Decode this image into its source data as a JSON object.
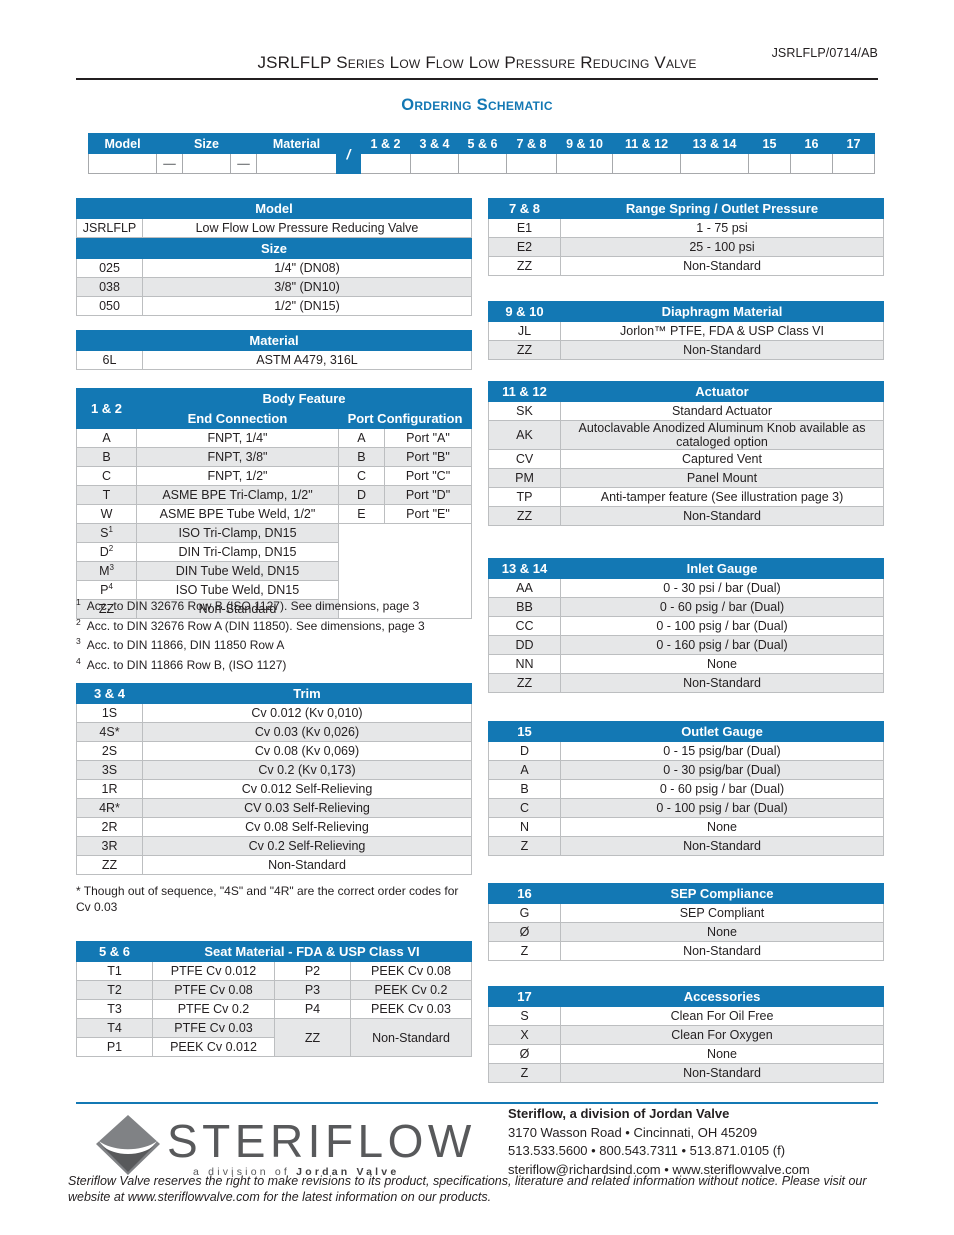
{
  "header": {
    "doc_code": "JSRLFLP/0714/AB",
    "title": "JSRLFLP Series Low Flow Low Pressure Reducing Valve",
    "section_title": "Ordering Schematic"
  },
  "colors": {
    "brand_blue": "#1378b4",
    "alt_row": "#e6e7e8",
    "border": "#bcbec0",
    "text": "#231f20",
    "logo_gray": "#58595b"
  },
  "schematic": {
    "headers": [
      "Model",
      "",
      "Size",
      "",
      "Material",
      "/",
      "1 & 2",
      "3 & 4",
      "5 & 6",
      "7 & 8",
      "9 & 10",
      "11 & 12",
      "13 & 14",
      "15",
      "16",
      "17"
    ],
    "separator": "—",
    "slash": "/"
  },
  "tables": {
    "model": {
      "code_header": "",
      "title": "Model",
      "rows": [
        {
          "code": "JSRLFLP",
          "desc": "Low Flow Low Pressure Reducing Valve"
        }
      ]
    },
    "size": {
      "title": "Size",
      "rows": [
        {
          "code": "025",
          "desc": "1/4\" (DN08)"
        },
        {
          "code": "038",
          "desc": "3/8\" (DN10)"
        },
        {
          "code": "050",
          "desc": "1/2\" (DN15)"
        }
      ]
    },
    "material": {
      "title": "Material",
      "rows": [
        {
          "code": "6L",
          "desc": "ASTM A479, 316L"
        }
      ]
    },
    "body_feature": {
      "code_label": "1 & 2",
      "title": "Body Feature",
      "sub_end": "End Connection",
      "sub_port": "Port Configuration",
      "end_rows": [
        {
          "code": "A",
          "desc": "FNPT, 1/4\""
        },
        {
          "code": "B",
          "desc": "FNPT, 3/8\""
        },
        {
          "code": "C",
          "desc": "FNPT, 1/2\""
        },
        {
          "code": "T",
          "desc": "ASME BPE Tri-Clamp, 1/2\""
        },
        {
          "code": "W",
          "desc": "ASME BPE Tube Weld, 1/2\""
        },
        {
          "code": "S",
          "sup": "1",
          "desc": "ISO Tri-Clamp, DN15"
        },
        {
          "code": "D",
          "sup": "2",
          "desc": "DIN Tri-Clamp, DN15"
        },
        {
          "code": "M",
          "sup": "3",
          "desc": "DIN Tube Weld, DN15"
        },
        {
          "code": "P",
          "sup": "4",
          "desc": "ISO Tube Weld, DN15"
        },
        {
          "code": "ZZ",
          "desc": "Non-Standard"
        }
      ],
      "port_rows": [
        {
          "code": "A",
          "desc": "Port \"A\""
        },
        {
          "code": "B",
          "desc": "Port \"B\""
        },
        {
          "code": "C",
          "desc": "Port \"C\""
        },
        {
          "code": "D",
          "desc": "Port \"D\""
        },
        {
          "code": "E",
          "desc": "Port \"E\""
        }
      ],
      "footnotes": [
        {
          "mark": "1",
          "text": "Acc. to DIN 32676 Row B (ISO 1127). See dimensions, page 3"
        },
        {
          "mark": "2",
          "text": "Acc. to DIN 32676 Row A (DIN 11850). See dimensions, page 3"
        },
        {
          "mark": "3",
          "text": "Acc. to DIN 11866, DIN 11850 Row A"
        },
        {
          "mark": "4",
          "text": "Acc. to DIN 11866 Row B, (ISO 1127)"
        }
      ]
    },
    "trim": {
      "code_label": "3 & 4",
      "title": "Trim",
      "rows": [
        {
          "code": "1S",
          "desc": "Cv 0.012 (Kv 0,010)"
        },
        {
          "code": "4S*",
          "desc": "Cv 0.03 (Kv 0,026)"
        },
        {
          "code": "2S",
          "desc": "Cv 0.08 (Kv 0,069)"
        },
        {
          "code": "3S",
          "desc": "Cv 0.2 (Kv 0,173)"
        },
        {
          "code": "1R",
          "desc": "Cv 0.012 Self-Relieving"
        },
        {
          "code": "4R*",
          "desc": "CV 0.03 Self-Relieving"
        },
        {
          "code": "2R",
          "desc": "Cv 0.08 Self-Relieving"
        },
        {
          "code": "3R",
          "desc": "Cv 0.2 Self-Relieving"
        },
        {
          "code": "ZZ",
          "desc": "Non-Standard"
        }
      ],
      "footnote": "* Though out of sequence, \"4S\" and \"4R\" are the correct order codes for Cv 0.03"
    },
    "seat_material": {
      "code_label": "5 & 6",
      "title": "Seat Material - FDA & USP Class VI",
      "left_rows": [
        {
          "code": "T1",
          "desc": "PTFE Cv 0.012"
        },
        {
          "code": "T2",
          "desc": "PTFE Cv 0.08"
        },
        {
          "code": "T3",
          "desc": "PTFE Cv 0.2"
        },
        {
          "code": "T4",
          "desc": "PTFE Cv 0.03"
        },
        {
          "code": "P1",
          "desc": "PEEK Cv 0.012"
        }
      ],
      "right_rows": [
        {
          "code": "P2",
          "desc": "PEEK Cv 0.08"
        },
        {
          "code": "P3",
          "desc": "PEEK Cv 0.2"
        },
        {
          "code": "P4",
          "desc": "PEEK Cv 0.03"
        },
        {
          "code": "ZZ",
          "desc": "Non-Standard"
        }
      ]
    },
    "range_spring": {
      "code_label": "7 & 8",
      "title": "Range Spring / Outlet Pressure",
      "rows": [
        {
          "code": "E1",
          "desc": "1 - 75 psi"
        },
        {
          "code": "E2",
          "desc": "25 - 100 psi"
        },
        {
          "code": "ZZ",
          "desc": "Non-Standard"
        }
      ]
    },
    "diaphragm": {
      "code_label": "9 & 10",
      "title": "Diaphragm Material",
      "rows": [
        {
          "code": "JL",
          "desc": "Jorlon™ PTFE, FDA & USP Class VI"
        },
        {
          "code": "ZZ",
          "desc": "Non-Standard"
        }
      ]
    },
    "actuator": {
      "code_label": "11 & 12",
      "title": "Actuator",
      "rows": [
        {
          "code": "SK",
          "desc": "Standard Actuator"
        },
        {
          "code": "AK",
          "desc": "Autoclavable Anodized Aluminum Knob available as cataloged option"
        },
        {
          "code": "CV",
          "desc": "Captured Vent"
        },
        {
          "code": "PM",
          "desc": "Panel Mount"
        },
        {
          "code": "TP",
          "desc": "Anti-tamper feature (See illustration page 3)"
        },
        {
          "code": "ZZ",
          "desc": "Non-Standard"
        }
      ]
    },
    "inlet_gauge": {
      "code_label": "13 & 14",
      "title": "Inlet Gauge",
      "rows": [
        {
          "code": "AA",
          "desc": "0 - 30 psi / bar (Dual)"
        },
        {
          "code": "BB",
          "desc": "0 - 60 psig / bar (Dual)"
        },
        {
          "code": "CC",
          "desc": "0 - 100 psig / bar (Dual)"
        },
        {
          "code": "DD",
          "desc": "0 - 160 psig / bar (Dual)"
        },
        {
          "code": "NN",
          "desc": "None"
        },
        {
          "code": "ZZ",
          "desc": "Non-Standard"
        }
      ]
    },
    "outlet_gauge": {
      "code_label": "15",
      "title": "Outlet Gauge",
      "rows": [
        {
          "code": "D",
          "desc": "0 - 15 psig/bar (Dual)"
        },
        {
          "code": "A",
          "desc": "0 - 30 psig/bar (Dual)"
        },
        {
          "code": "B",
          "desc": "0 - 60 psig / bar (Dual)"
        },
        {
          "code": "C",
          "desc": "0 - 100 psig / bar (Dual)"
        },
        {
          "code": "N",
          "desc": "None"
        },
        {
          "code": "Z",
          "desc": "Non-Standard"
        }
      ]
    },
    "sep_compliance": {
      "code_label": "16",
      "title": "SEP Compliance",
      "rows": [
        {
          "code": "G",
          "desc": "SEP Compliant"
        },
        {
          "code": "Ø",
          "desc": "None"
        },
        {
          "code": "Z",
          "desc": "Non-Standard"
        }
      ]
    },
    "accessories": {
      "code_label": "17",
      "title": "Accessories",
      "rows": [
        {
          "code": "S",
          "desc": "Clean For Oil Free"
        },
        {
          "code": "X",
          "desc": "Clean For Oxygen"
        },
        {
          "code": "Ø",
          "desc": "None"
        },
        {
          "code": "Z",
          "desc": "Non-Standard"
        }
      ]
    }
  },
  "footer": {
    "logo_word": "STERIFLOW",
    "logo_sub_plain_1": "a division of ",
    "logo_sub_bold": "Jordan Valve",
    "company": "Steriflow, a division of Jordan Valve",
    "address": "3170 Wasson Road  •  Cincinnati, OH  45209",
    "phones": "513.533.5600  •  800.543.7311  •  513.871.0105 (f)",
    "web": "steriflow@richardsind.com  •  www.steriflowvalve.com",
    "disclaimer": "Steriflow Valve reserves the right to make revisions to its product, specifications, literature and related information without notice. Please visit our website at www.steriflowvalve.com for the latest information on our products."
  }
}
